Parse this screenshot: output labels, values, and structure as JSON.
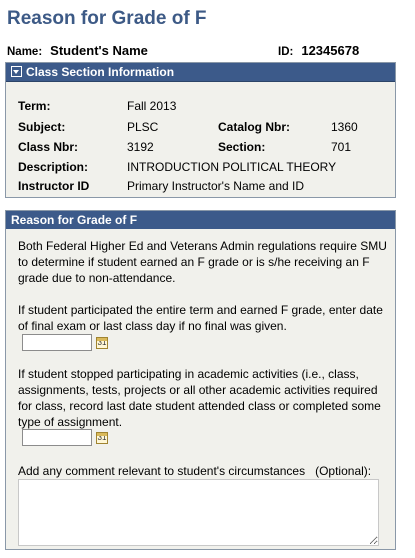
{
  "page": {
    "title": "Reason for Grade of F"
  },
  "student": {
    "name_label": "Name:",
    "name_value": "Student's Name",
    "id_label": "ID:",
    "id_value": "12345678"
  },
  "class_section": {
    "header": "Class Section Information",
    "term_label": "Term:",
    "term_value": "Fall 2013",
    "subject_label": "Subject:",
    "subject_value": "PLSC",
    "catalog_label": "Catalog Nbr:",
    "catalog_value": "1360",
    "classnbr_label": "Class Nbr:",
    "classnbr_value": "3192",
    "section_label": "Section:",
    "section_value": "701",
    "description_label": "Description:",
    "description_value": "INTRODUCTION POLITICAL THEORY",
    "instructor_label": "Instructor ID",
    "instructor_value": "Primary Instructor's Name and ID"
  },
  "reason": {
    "header": "Reason for Grade of F",
    "intro": "Both Federal Higher Ed and Veterans Admin regulations require SMU to determine if student earned an F grade or is s/he receiving an F grade due to non-attendance.",
    "q1": "If student participated the entire term and earned F grade, enter date of final exam or last class day if no final was given.",
    "q1_value": "",
    "q2": "If student stopped participating in academic activities (i.e., class, assignments, tests, projects or all other academic activities required for class, record last date student attended class or completed some type of assignment.",
    "q2_value": "",
    "comment_label": "Add any comment relevant to student's circumstances   (Optional):",
    "comment_value": "",
    "calendar_icon_text": "31"
  },
  "colors": {
    "title": "#3d5a86",
    "header_bg": "#3c5a8a",
    "panel_bg": "#f1f1ec"
  }
}
